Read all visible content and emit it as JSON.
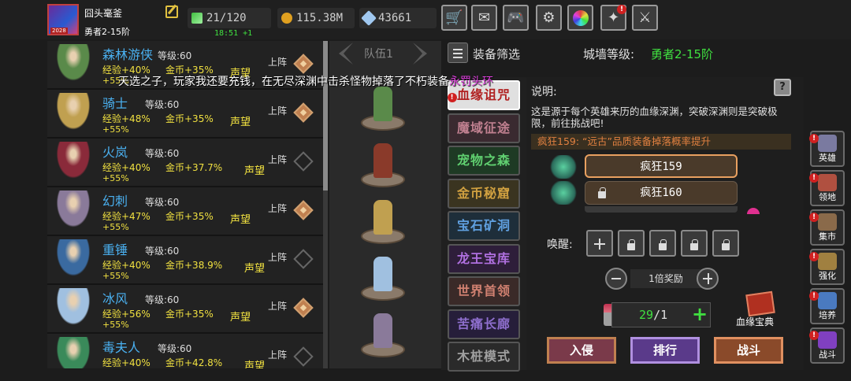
{
  "player": {
    "name": "囧头毫釜",
    "rank": "勇者2-15阶",
    "avatar_level": "2028"
  },
  "resources": {
    "stamina": "21/120",
    "stamina_regen": "18:51 +1",
    "gold": "115.38M",
    "gems": "43661"
  },
  "top_menu": [
    "shop",
    "mail",
    "gamepad",
    "settings",
    "color-wheel",
    "sword-alert",
    "swords-locked"
  ],
  "heroes": [
    {
      "name": "森林游侠",
      "level": "等级:60",
      "exp": "经验+40%",
      "gold": "金币+35%",
      "fame": "声望",
      "extra": "+55%",
      "action": "上阵",
      "selected": true,
      "color": "#5a8a4a"
    },
    {
      "name": "骑士",
      "level": "等级:60",
      "exp": "经验+48%",
      "gold": "金币+35%",
      "fame": "声望",
      "extra": "+55%",
      "action": "上阵",
      "selected": true,
      "color": "#c0a050"
    },
    {
      "name": "火岚",
      "level": "等级:60",
      "exp": "经验+40%",
      "gold": "金币+37.7%",
      "fame": "声望",
      "extra": "+55%",
      "action": "上阵",
      "selected": false,
      "color": "#8a2a3a"
    },
    {
      "name": "幻刺",
      "level": "等级:60",
      "exp": "经验+47%",
      "gold": "金币+35%",
      "fame": "声望",
      "extra": "+55%",
      "action": "上阵",
      "selected": true,
      "color": "#8a7a9a"
    },
    {
      "name": "重锤",
      "level": "等级:60",
      "exp": "经验+40%",
      "gold": "金币+38.9%",
      "fame": "声望",
      "extra": "+55%",
      "action": "上阵",
      "selected": false,
      "color": "#3a6aa0"
    },
    {
      "name": "冰风",
      "level": "等级:60",
      "exp": "经验+56%",
      "gold": "金币+35%",
      "fame": "声望",
      "extra": "+55%",
      "action": "上阵",
      "selected": true,
      "color": "#a0c0e0"
    },
    {
      "name": "毒夫人",
      "level": "等级:60",
      "exp": "经验+40%",
      "gold": "金币+42.8%",
      "fame": "声望",
      "extra": "",
      "action": "上阵",
      "selected": false,
      "color": "#3a8a5a"
    }
  ],
  "team": {
    "title": "队伍1"
  },
  "filter": {
    "label": "装备筛选"
  },
  "city_wall": {
    "label": "城墙等级:",
    "value": "勇者2-15阶"
  },
  "dungeon_tabs": [
    {
      "label": "血缘诅咒",
      "active": true,
      "badge": "!"
    },
    {
      "label": "魔域征途"
    },
    {
      "label": "宠物之森"
    },
    {
      "label": "金币秘窟"
    },
    {
      "label": "宝石矿洞"
    },
    {
      "label": "龙王宝库"
    },
    {
      "label": "世界首领"
    },
    {
      "label": "苦痛长廊"
    },
    {
      "label": "木桩模式"
    }
  ],
  "detail": {
    "title": "说明:",
    "description": "这是源于每个英雄来历的血缘深渊，突破深渊则是突破极限，前往挑战吧!",
    "bonus": "疯狂159: “远古”品质装备掉落概率提升",
    "stages": [
      {
        "label": "疯狂159",
        "locked": false
      },
      {
        "label": "疯狂160",
        "locked": true
      }
    ],
    "awaken_label": "唤醒:",
    "multiplier": "1倍奖励",
    "tries": {
      "current": "29",
      "max": "/1"
    },
    "codex_label": "血缘宝典",
    "buttons": {
      "invade": "入侵",
      "rank": "排行",
      "battle": "战斗"
    }
  },
  "side_menu": [
    {
      "label": "英雄",
      "badge": "!",
      "color": "#7a7aa0"
    },
    {
      "label": "领地",
      "badge": "!",
      "color": "#b05040"
    },
    {
      "label": "集市",
      "badge": "!",
      "color": "#8a6a4a"
    },
    {
      "label": "强化",
      "badge": "!",
      "color": "#a08040"
    },
    {
      "label": "培养",
      "badge": "!",
      "color": "#4a7ac0"
    },
    {
      "label": "战斗",
      "badge": "!",
      "color": "#8040c0"
    }
  ],
  "banner": {
    "text": "天选之子，玩家我还要充钱，在无尽深渊中击杀怪物掉落了不朽装备",
    "item": "永罚头环"
  },
  "colors": {
    "accent_green": "#40e040",
    "hero_name": "#4ab0f0",
    "stat_yellow": "#f0e040",
    "bonus_orange": "#e08040",
    "banner_item": "#e040e0"
  }
}
